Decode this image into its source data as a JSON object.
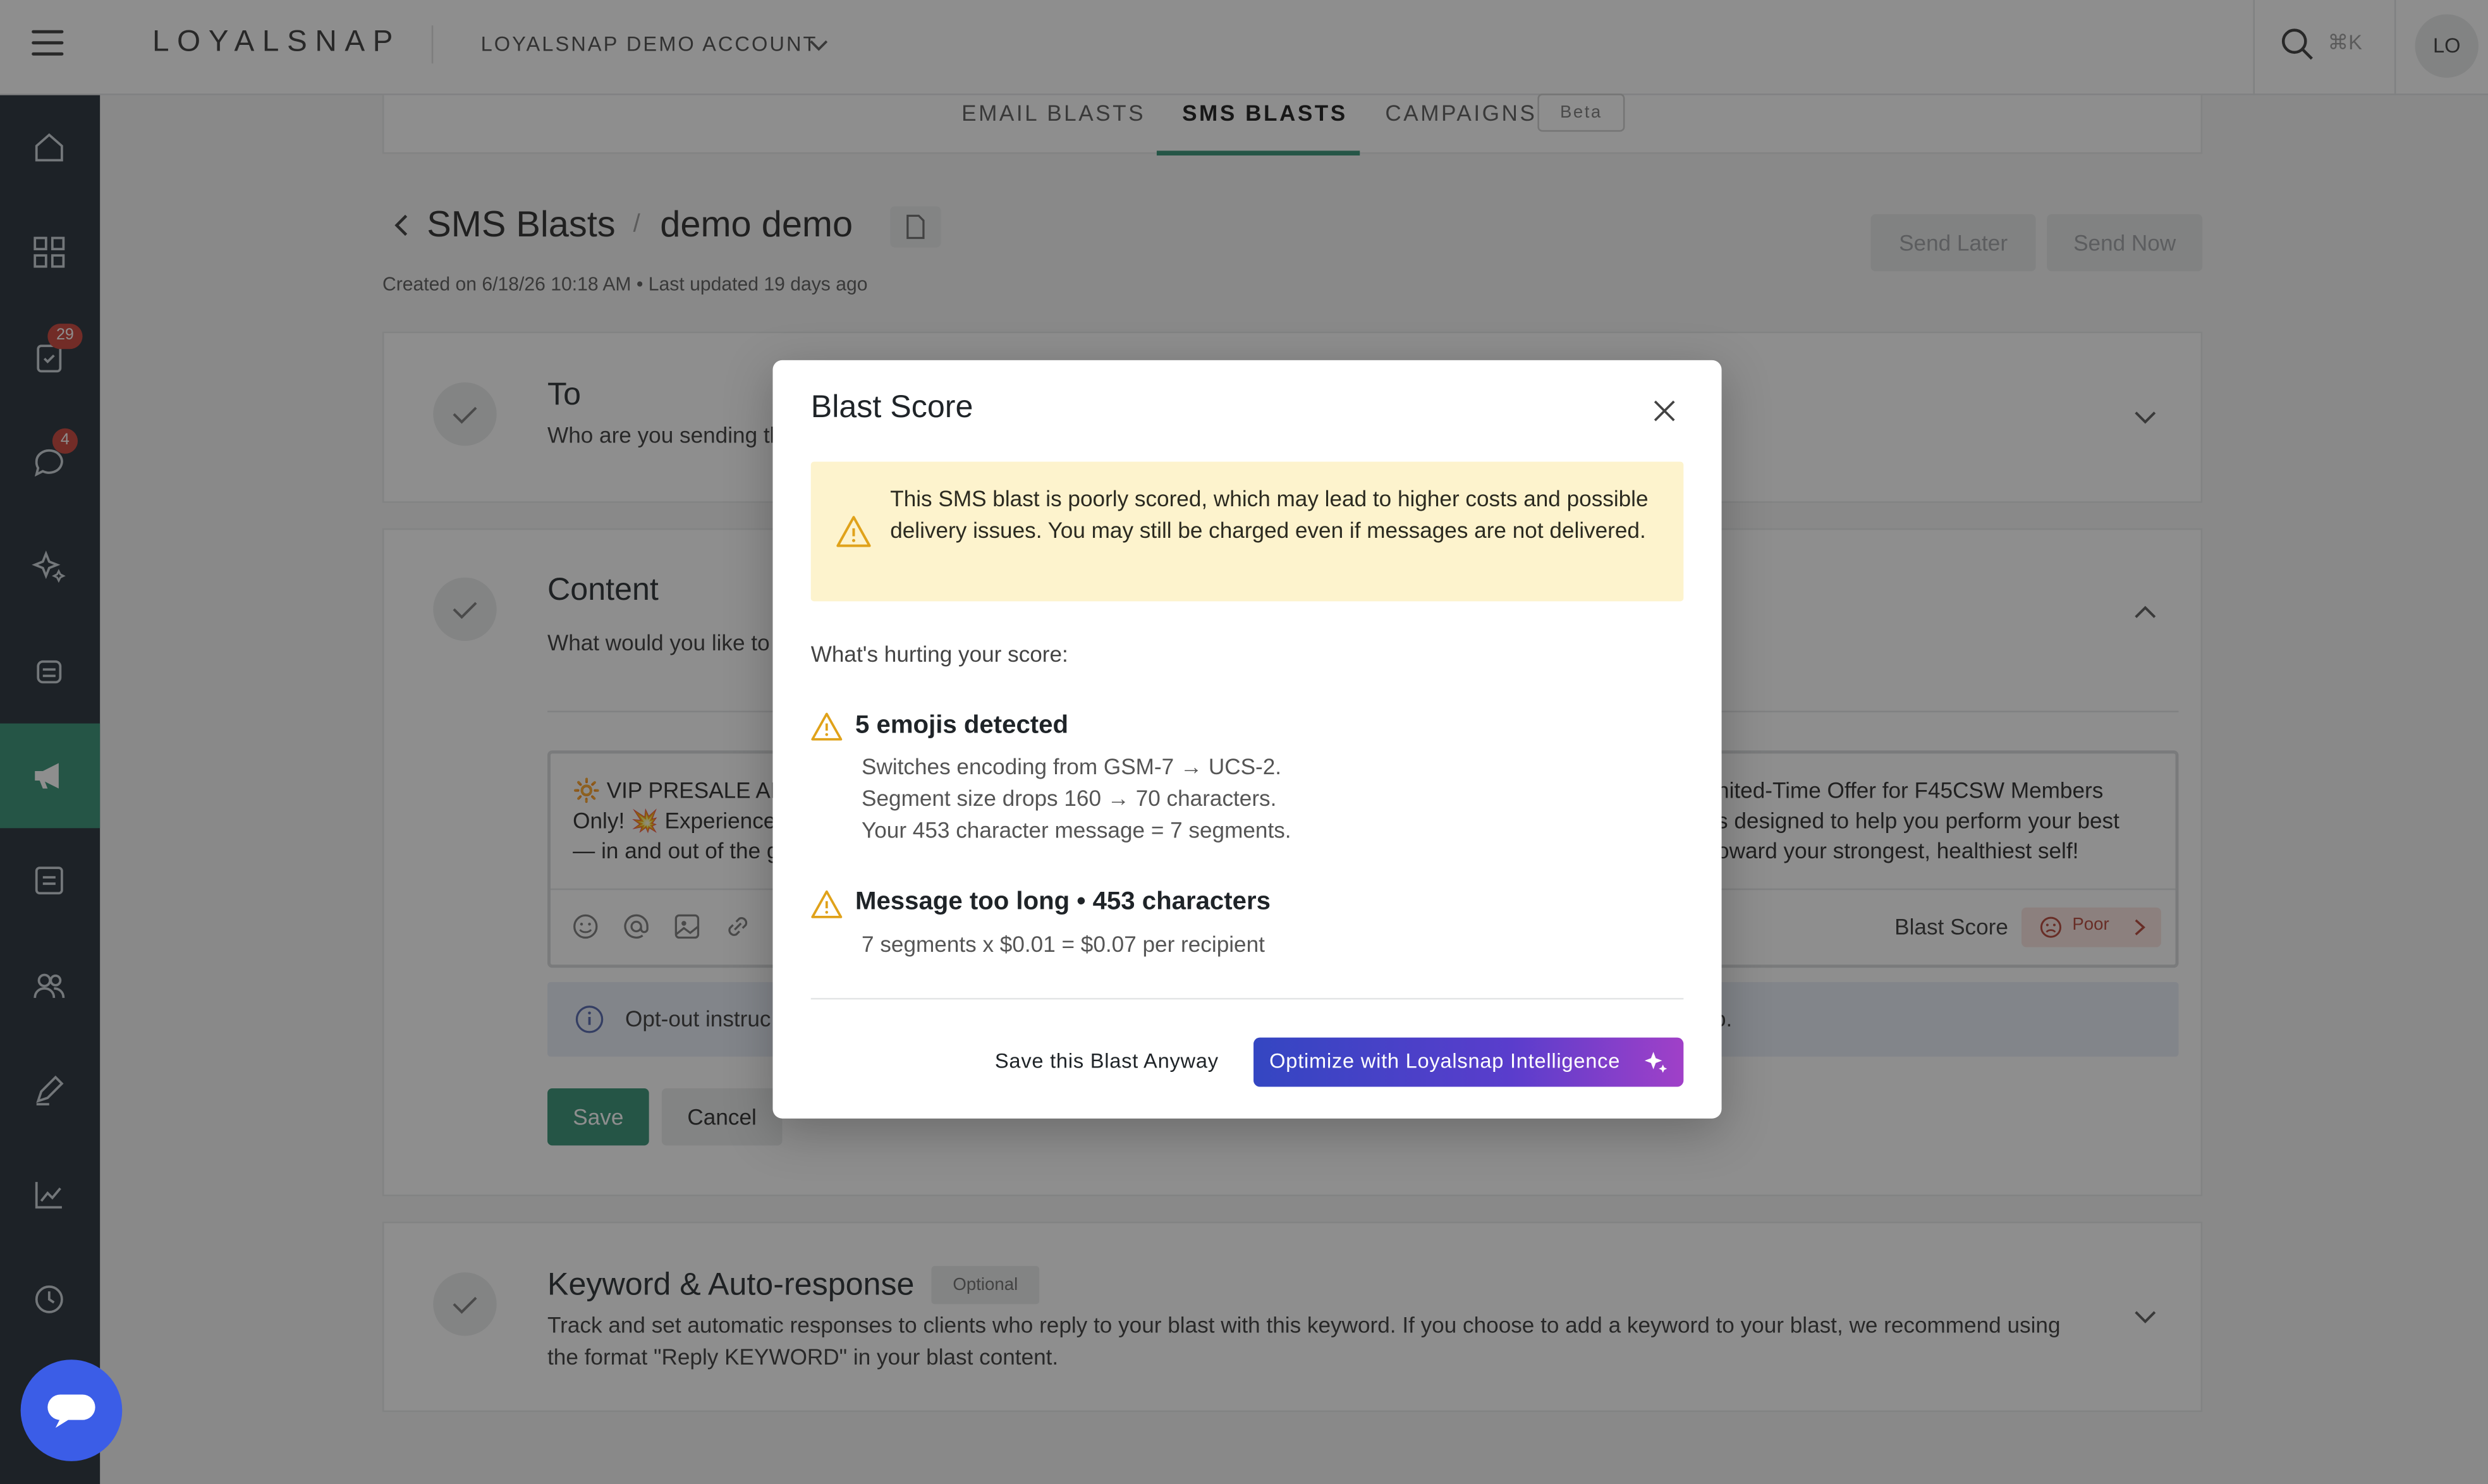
{
  "header": {
    "logo": "LOYALSNAP",
    "account": "LOYALSNAP DEMO ACCOUNT",
    "search_shortcut": "⌘K",
    "avatar_initials": "LO"
  },
  "sidebar": {
    "badges": {
      "tasks": "29",
      "messages": "4"
    }
  },
  "tabs": [
    {
      "label": "EMAIL BLASTS"
    },
    {
      "label": "SMS BLASTS"
    },
    {
      "label": "CAMPAIGNS"
    }
  ],
  "beta_tag": "Beta",
  "breadcrumb": {
    "parent": "SMS Blasts",
    "separator": "/",
    "current": "demo demo"
  },
  "meta": "Created on 6/18/26 10:18 AM  •  Last updated 19 days ago",
  "actions": {
    "send_later": "Send Later",
    "send_now": "Send Now"
  },
  "sections": {
    "to": {
      "title": "To",
      "subtitle": "Who are you sending th"
    },
    "content": {
      "title": "Content",
      "subtitle": "What would you like to",
      "editor_left": [
        "🔆 VIP PRESALE ALL",
        "Only! 💥 Experience",
        "— in and out of the g"
      ],
      "editor_right": [
        "nited-Time Offer for F45CSW Members",
        "s designed to help you perform your best",
        "oward your strongest, healthiest self!"
      ],
      "blast_score_label": "Blast Score",
      "blast_score_value": "Poor",
      "optout_text": "Opt-out instruc",
      "optout_tail": "o.",
      "save": "Save",
      "cancel": "Cancel"
    },
    "keyword": {
      "title": "Keyword & Auto-response",
      "optional": "Optional",
      "line1": "Track and set automatic responses to clients who reply to your blast with this keyword. If you choose to add a keyword to your blast, we recommend using",
      "line2": "the format \"Reply KEYWORD\" in your blast content."
    }
  },
  "modal": {
    "title": "Blast Score",
    "warning": "This SMS blast is poorly scored, which may lead to higher costs and possible delivery issues. You may still be charged even if messages are not delivered.",
    "hurting_label": "What's hurting your score:",
    "issues": [
      {
        "title": "5 emojis detected",
        "lines": [
          "Switches encoding from GSM-7 → UCS-2.",
          "Segment size drops 160 → 70 characters.",
          "Your 453 character message = 7 segments."
        ]
      },
      {
        "title": "Message too long • 453 characters",
        "lines": [
          "7 segments x $0.01 = $0.07 per recipient"
        ]
      }
    ],
    "save_anyway": "Save this Blast Anyway",
    "optimize": "Optimize with Loyalsnap Intelligence"
  },
  "colors": {
    "sidebar": "#1c2630",
    "accent": "#2c8c6f",
    "warning_bg": "#fdf3cd",
    "warning_icon": "#e0a21a",
    "poor": "#b33c2e"
  }
}
